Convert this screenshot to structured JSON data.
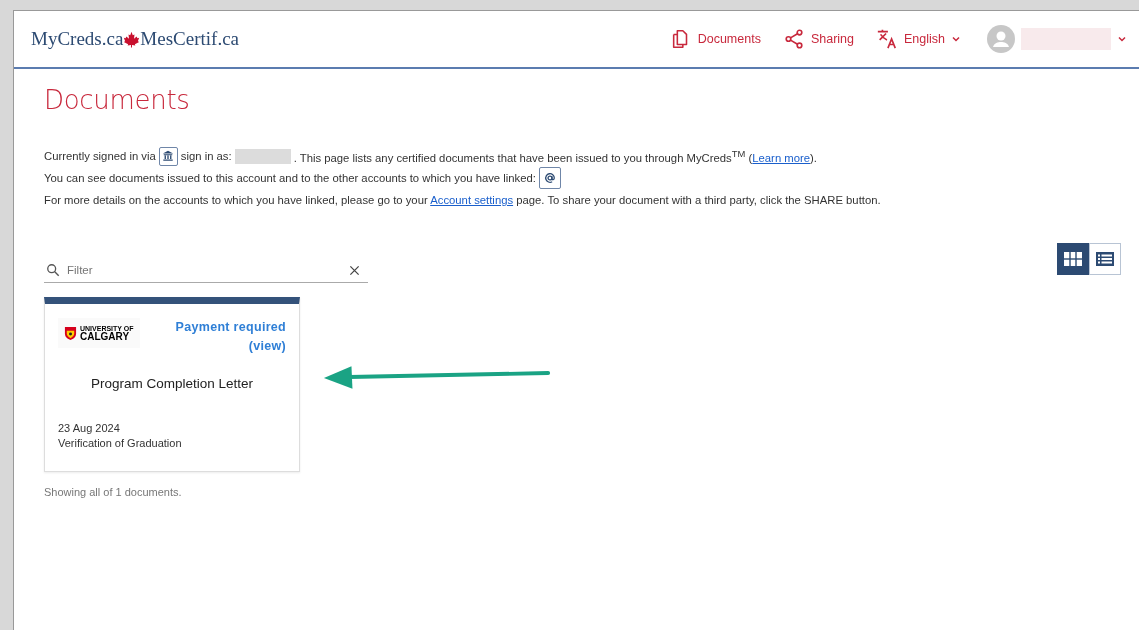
{
  "header": {
    "logo_left": "MyCreds.ca",
    "logo_right": "MesCertif.ca",
    "nav": [
      {
        "kind": "documents",
        "label": "Documents"
      },
      {
        "kind": "sharing",
        "label": "Sharing"
      },
      {
        "kind": "language",
        "label": "English"
      }
    ]
  },
  "page": {
    "title": "Documents",
    "intro": {
      "signed_in": "Currently signed in via",
      "sign_in_as": "sign in as:",
      "lists": ". This page lists any certified documents that have been issued to you through MyCreds$^{TM}$ (",
      "learn_more": "Learn more",
      "lists_end": ").",
      "linked": "You can see documents issued to this account and to the other accounts to which you have linked:",
      "details": "For more details on the accounts to which you have linked, please go to your",
      "account_settings": "Account settings",
      "details_end": "page. To share your document with a third party, click the SHARE button."
    },
    "filter": {
      "placeholder": "Filter"
    },
    "views": [
      {
        "kind": "grid",
        "selected": true
      },
      {
        "kind": "list",
        "selected": false
      }
    ],
    "documents": [
      {
        "issuer_small": "UNIVERSITY OF",
        "issuer_big": "CALGARY",
        "status": [
          "Payment required",
          "(view)"
        ],
        "title": "Program Completion Letter",
        "date": "23 Aug 2024",
        "type": "Verification of Graduation"
      }
    ],
    "count": "Showing all of 1 documents."
  }
}
